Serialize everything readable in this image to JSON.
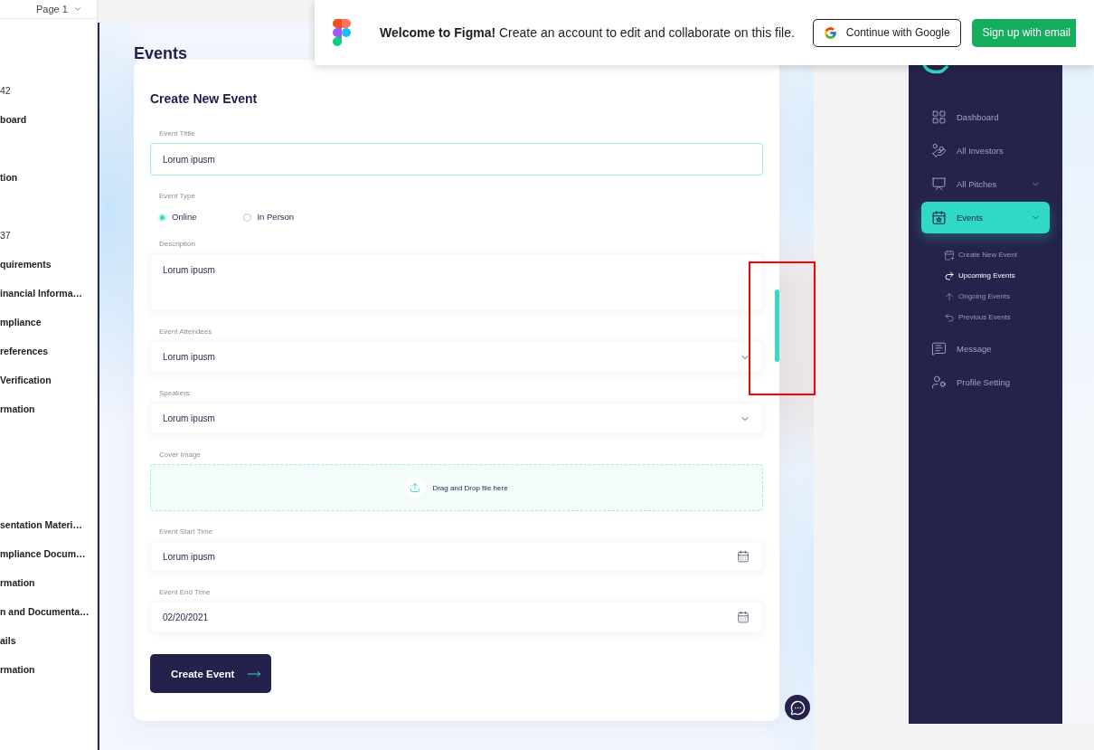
{
  "figma_banner": {
    "message": "**Welcome to Figma!** Create an account to edit and collaborate on this file.",
    "buttons": [
      {
        "kind": "outline",
        "label": "Continue with Google"
      },
      {
        "kind": "primary",
        "label": "Sign up with email"
      }
    ]
  },
  "layers_panel": {
    "page_label": "Page 1",
    "groups": [
      [
        {
          "text": "42",
          "bold": false
        },
        {
          "text": "board",
          "bold": true
        }
      ],
      [
        {
          "text": "tion",
          "bold": true
        }
      ],
      [
        {
          "text": "37",
          "bold": false
        },
        {
          "text": "quirements",
          "bold": true
        },
        {
          "text": "inancial Informa…",
          "bold": true
        },
        {
          "text": "mpliance",
          "bold": true
        },
        {
          "text": "references",
          "bold": true
        },
        {
          "text": "Verification",
          "bold": true
        },
        {
          "text": "rmation",
          "bold": true
        }
      ],
      [
        {
          "text": "sentation Materi…",
          "bold": true
        },
        {
          "text": "mpliance Docum…",
          "bold": true
        },
        {
          "text": "rmation",
          "bold": true
        },
        {
          "text": "n and Documenta…",
          "bold": true
        },
        {
          "text": "ails",
          "bold": true
        },
        {
          "text": "rmation",
          "bold": true
        }
      ]
    ]
  },
  "events_frame": {
    "heading": "Events",
    "form": {
      "title": "Create New Event",
      "fields": [
        {
          "kind": "text",
          "label": "Event Tittle",
          "value": "Lorum ipusm",
          "focused": true
        },
        {
          "kind": "radio",
          "label": "Event Type",
          "options": [
            {
              "label": "Online",
              "selected": true
            },
            {
              "label": "In Person",
              "selected": false
            }
          ]
        },
        {
          "kind": "textarea",
          "label": "Description",
          "value": "Lorum ipusm",
          "focused": false
        },
        {
          "kind": "select",
          "label": "Event Attendees",
          "value": "Lorum ipusm",
          "focused": false
        },
        {
          "kind": "select",
          "label": "Speakers",
          "value": "Lorum ipusm",
          "focused": false
        },
        {
          "kind": "upload",
          "label": "Cover Image",
          "hint": "Drag and Drop file here"
        },
        {
          "kind": "date",
          "label": "Event Start Time",
          "value": "Lorum ipusm",
          "focused": false
        },
        {
          "kind": "date",
          "label": "Event End Time",
          "value": "02/20/2021",
          "focused": false
        }
      ],
      "submit": {
        "label": "Create Event"
      }
    }
  },
  "sidebar": {
    "items": [
      {
        "kind": "link",
        "label": "Dashboard",
        "selected": false
      },
      {
        "kind": "link",
        "label": "All Investors",
        "selected": false
      },
      {
        "kind": "group",
        "label": "All Pitches",
        "selected": false
      },
      {
        "kind": "group",
        "label": "Events",
        "selected": true,
        "children": [
          {
            "label": "Create New Event",
            "selected": false
          },
          {
            "label": "Upcoming Events",
            "selected": true
          },
          {
            "label": "Ongoing Events",
            "selected": false
          },
          {
            "label": "Previous Events",
            "selected": false
          }
        ]
      },
      {
        "kind": "link",
        "label": "Message",
        "selected": false
      },
      {
        "kind": "link",
        "label": "Profile Setting",
        "selected": false
      }
    ]
  }
}
